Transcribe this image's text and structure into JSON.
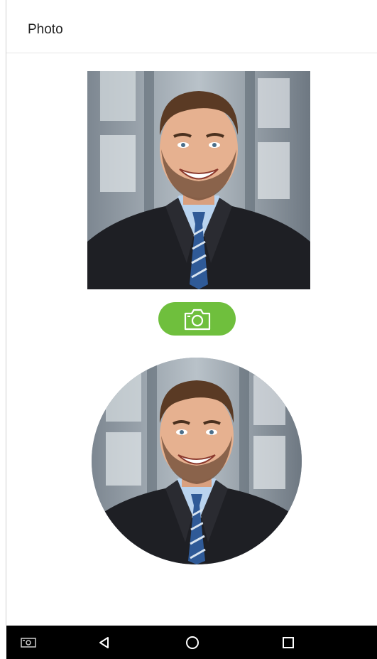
{
  "header": {
    "title": "Photo"
  },
  "photo": {
    "square_label": "portrait-photo-square",
    "round_label": "portrait-photo-round"
  },
  "camera_button": {
    "icon": "camera-icon",
    "color": "#6fbf3d"
  },
  "navbar": {
    "items": [
      {
        "icon": "screenshot-icon"
      },
      {
        "icon": "back-icon"
      },
      {
        "icon": "home-icon"
      },
      {
        "icon": "recents-icon"
      }
    ],
    "background": "#000000"
  }
}
